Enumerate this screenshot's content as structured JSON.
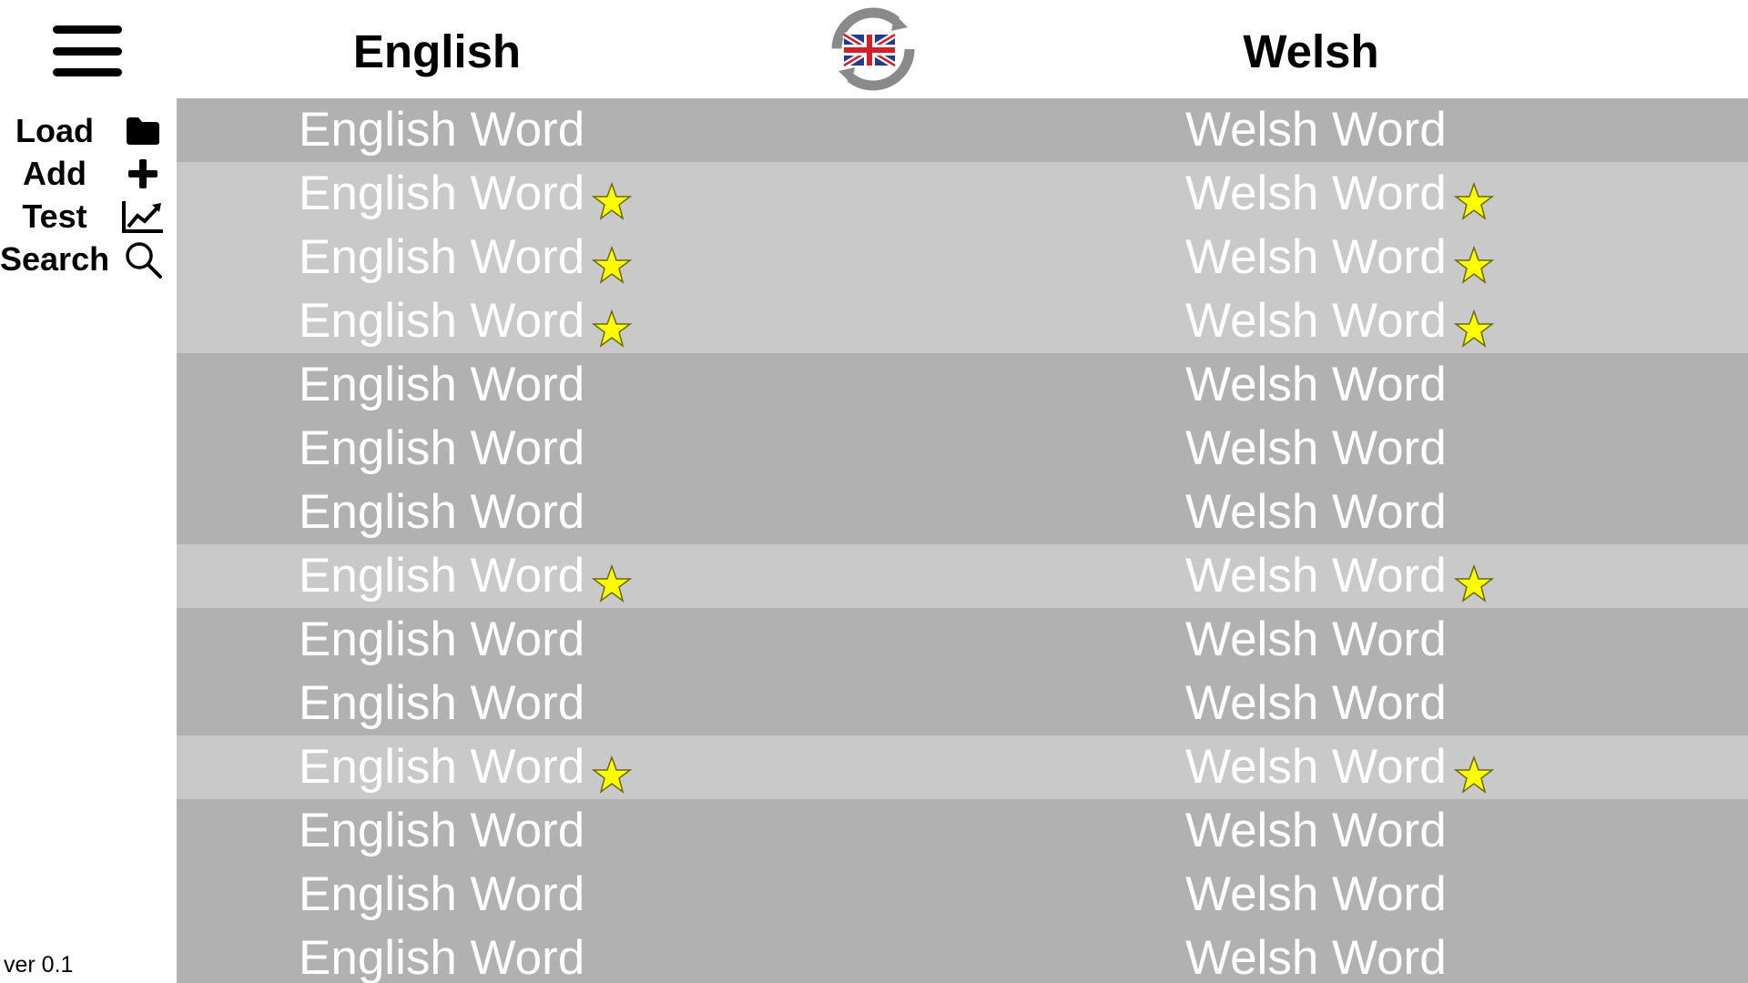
{
  "header": {
    "menu_icon": "hamburger-menu-icon",
    "left_language": "English",
    "right_language": "Welsh",
    "swap_icon": "language-swap-flag-icon"
  },
  "sidebar": {
    "items": [
      {
        "label": "Load",
        "icon": "folder-icon"
      },
      {
        "label": "Add",
        "icon": "plus-icon"
      },
      {
        "label": "Test",
        "icon": "chart-line-icon"
      },
      {
        "label": "Search",
        "icon": "search-icon"
      }
    ]
  },
  "version": "ver 0.1",
  "colors": {
    "row_default": "#b1b1b1",
    "row_favorite": "#c9c9c9",
    "star": "#ffff00",
    "word_text": "#ffffff"
  },
  "words": [
    {
      "english": "English Word",
      "welsh": "Welsh Word",
      "favorite": false
    },
    {
      "english": "English Word",
      "welsh": "Welsh Word",
      "favorite": true
    },
    {
      "english": "English Word",
      "welsh": "Welsh Word",
      "favorite": true
    },
    {
      "english": "English Word",
      "welsh": "Welsh Word",
      "favorite": true
    },
    {
      "english": "English Word",
      "welsh": "Welsh Word",
      "favorite": false
    },
    {
      "english": "English Word",
      "welsh": "Welsh Word",
      "favorite": false
    },
    {
      "english": "English Word",
      "welsh": "Welsh Word",
      "favorite": false
    },
    {
      "english": "English Word",
      "welsh": "Welsh Word",
      "favorite": true
    },
    {
      "english": "English Word",
      "welsh": "Welsh Word",
      "favorite": false
    },
    {
      "english": "English Word",
      "welsh": "Welsh Word",
      "favorite": false
    },
    {
      "english": "English Word",
      "welsh": "Welsh Word",
      "favorite": true
    },
    {
      "english": "English Word",
      "welsh": "Welsh Word",
      "favorite": false
    },
    {
      "english": "English Word",
      "welsh": "Welsh Word",
      "favorite": false
    },
    {
      "english": "English Word",
      "welsh": "Welsh Word",
      "favorite": false
    }
  ]
}
